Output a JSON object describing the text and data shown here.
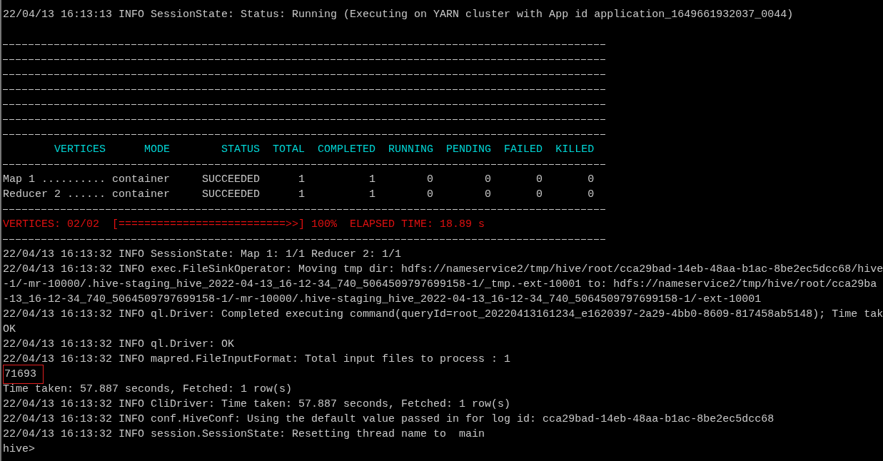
{
  "lines": [
    {
      "kind": "text",
      "text": "22/04/13 16:13:13 INFO SessionState: Status: Running (Executing on YARN cluster with App id application_1649661932037_0044)"
    },
    {
      "kind": "blank"
    },
    {
      "kind": "rule"
    },
    {
      "kind": "rule"
    },
    {
      "kind": "rule"
    },
    {
      "kind": "rule"
    },
    {
      "kind": "rule"
    },
    {
      "kind": "rule"
    },
    {
      "kind": "rule"
    },
    {
      "kind": "header",
      "text": "        VERTICES      MODE        STATUS  TOTAL  COMPLETED  RUNNING  PENDING  FAILED  KILLED"
    },
    {
      "kind": "rule"
    },
    {
      "kind": "row",
      "text": "Map 1 .......... container     SUCCEEDED      1          1        0        0       0       0"
    },
    {
      "kind": "row",
      "text": "Reducer 2 ...... container     SUCCEEDED      1          1        0        0       0       0"
    },
    {
      "kind": "rule"
    },
    {
      "kind": "progress",
      "text": "VERTICES: 02/02  [==========================>>] 100%  ELAPSED TIME: 18.89 s"
    },
    {
      "kind": "rule"
    },
    {
      "kind": "text",
      "text": "22/04/13 16:13:32 INFO SessionState: Map 1: 1/1 Reducer 2: 1/1"
    },
    {
      "kind": "text",
      "text": "22/04/13 16:13:32 INFO exec.FileSinkOperator: Moving tmp dir: hdfs://nameservice2/tmp/hive/root/cca29bad-14eb-48aa-b1ac-8be2ec5dcc68/hive"
    },
    {
      "kind": "text",
      "text": "-1/-mr-10000/.hive-staging_hive_2022-04-13_16-12-34_740_5064509797699158-1/_tmp.-ext-10001 to: hdfs://nameservice2/tmp/hive/root/cca29ba"
    },
    {
      "kind": "text",
      "text": "-13_16-12-34_740_5064509797699158-1/-mr-10000/.hive-staging_hive_2022-04-13_16-12-34_740_5064509797699158-1/-ext-10001"
    },
    {
      "kind": "text",
      "text": "22/04/13 16:13:32 INFO ql.Driver: Completed executing command(queryId=root_20220413161234_e1620397-2a29-4bb0-8609-817458ab5148); Time tak"
    },
    {
      "kind": "text",
      "text": "OK"
    },
    {
      "kind": "text",
      "text": "22/04/13 16:13:32 INFO ql.Driver: OK"
    },
    {
      "kind": "text",
      "text": "22/04/13 16:13:32 INFO mapred.FileInputFormat: Total input files to process : 1"
    },
    {
      "kind": "boxed",
      "text": "71693"
    },
    {
      "kind": "text",
      "text": "Time taken: 57.887 seconds, Fetched: 1 row(s)"
    },
    {
      "kind": "text",
      "text": "22/04/13 16:13:32 INFO CliDriver: Time taken: 57.887 seconds, Fetched: 1 row(s)"
    },
    {
      "kind": "text",
      "text": "22/04/13 16:13:32 INFO conf.HiveConf: Using the default value passed in for log id: cca29bad-14eb-48aa-b1ac-8be2ec5dcc68"
    },
    {
      "kind": "text",
      "text": "22/04/13 16:13:32 INFO session.SessionState: Resetting thread name to  main"
    },
    {
      "kind": "prompt",
      "text": "hive>"
    }
  ]
}
